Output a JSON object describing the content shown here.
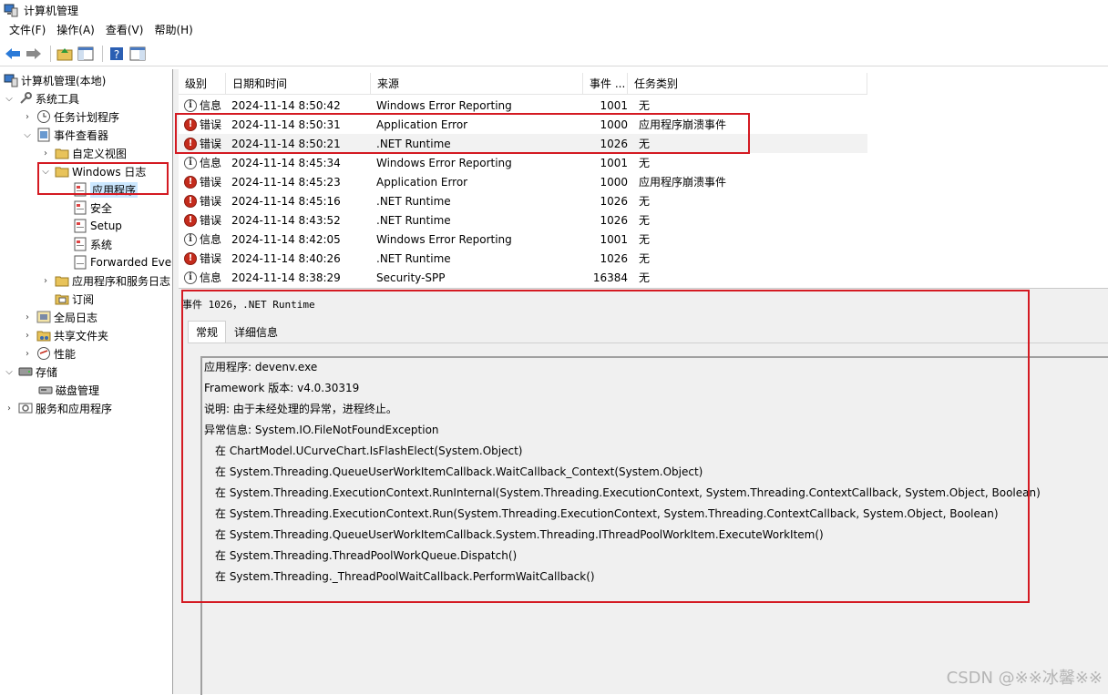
{
  "window": {
    "title": "计算机管理"
  },
  "menu": [
    "文件(F)",
    "操作(A)",
    "查看(V)",
    "帮助(H)"
  ],
  "tree": {
    "root": "计算机管理(本地)",
    "system_tools": "系统工具",
    "task_scheduler": "任务计划程序",
    "event_viewer": "事件查看器",
    "custom_views": "自定义视图",
    "windows_logs": "Windows 日志",
    "application": "应用程序",
    "security": "安全",
    "setup": "Setup",
    "system": "系统",
    "forwarded": "Forwarded Eve",
    "app_service_logs": "应用程序和服务日志",
    "subscriptions": "订阅",
    "global_log": "全局日志",
    "shared_folders": "共享文件夹",
    "performance": "性能",
    "storage": "存储",
    "disk_mgmt": "磁盘管理",
    "services_apps": "服务和应用程序"
  },
  "grid": {
    "headers": {
      "level": "级别",
      "datetime": "日期和时间",
      "source": "来源",
      "event_id": "事件 ...",
      "category": "任务类别"
    },
    "rows": [
      {
        "type": "info",
        "level": "信息",
        "datetime": "2024-11-14 8:50:42",
        "source": "Windows Error Reporting",
        "id": "1001",
        "category": "无"
      },
      {
        "type": "error",
        "level": "错误",
        "datetime": "2024-11-14 8:50:31",
        "source": "Application Error",
        "id": "1000",
        "category": "应用程序崩溃事件"
      },
      {
        "type": "error",
        "level": "错误",
        "datetime": "2024-11-14 8:50:21",
        "source": ".NET Runtime",
        "id": "1026",
        "category": "无"
      },
      {
        "type": "info",
        "level": "信息",
        "datetime": "2024-11-14 8:45:34",
        "source": "Windows Error Reporting",
        "id": "1001",
        "category": "无"
      },
      {
        "type": "error",
        "level": "错误",
        "datetime": "2024-11-14 8:45:23",
        "source": "Application Error",
        "id": "1000",
        "category": "应用程序崩溃事件"
      },
      {
        "type": "error",
        "level": "错误",
        "datetime": "2024-11-14 8:45:16",
        "source": ".NET Runtime",
        "id": "1026",
        "category": "无"
      },
      {
        "type": "error",
        "level": "错误",
        "datetime": "2024-11-14 8:43:52",
        "source": ".NET Runtime",
        "id": "1026",
        "category": "无"
      },
      {
        "type": "info",
        "level": "信息",
        "datetime": "2024-11-14 8:42:05",
        "source": "Windows Error Reporting",
        "id": "1001",
        "category": "无"
      },
      {
        "type": "error",
        "level": "错误",
        "datetime": "2024-11-14 8:40:26",
        "source": ".NET Runtime",
        "id": "1026",
        "category": "无"
      },
      {
        "type": "info",
        "level": "信息",
        "datetime": "2024-11-14 8:38:29",
        "source": "Security-SPP",
        "id": "16384",
        "category": "无"
      }
    ]
  },
  "detail": {
    "title": "事件 1026，.NET Runtime",
    "tab_general": "常规",
    "tab_details": "详细信息",
    "lines": [
      "应用程序: devenv.exe",
      "Framework 版本: v4.0.30319",
      "说明: 由于未经处理的异常，进程终止。",
      "异常信息: System.IO.FileNotFoundException",
      "在 ChartModel.UCurveChart.IsFlashElect(System.Object)",
      "在 System.Threading.QueueUserWorkItemCallback.WaitCallback_Context(System.Object)",
      "在 System.Threading.ExecutionContext.RunInternal(System.Threading.ExecutionContext, System.Threading.ContextCallback, System.Object, Boolean)",
      "在 System.Threading.ExecutionContext.Run(System.Threading.ExecutionContext, System.Threading.ContextCallback, System.Object, Boolean)",
      "在 System.Threading.QueueUserWorkItemCallback.System.Threading.IThreadPoolWorkItem.ExecuteWorkItem()",
      "在 System.Threading.ThreadPoolWorkQueue.Dispatch()",
      "在 System.Threading._ThreadPoolWaitCallback.PerformWaitCallback()"
    ]
  },
  "watermark": "CSDN @※※冰馨※※",
  "colors": {
    "highlight_box": "#d41a22",
    "selected": "#cce8ff",
    "error_icon": "#c42b1c"
  }
}
